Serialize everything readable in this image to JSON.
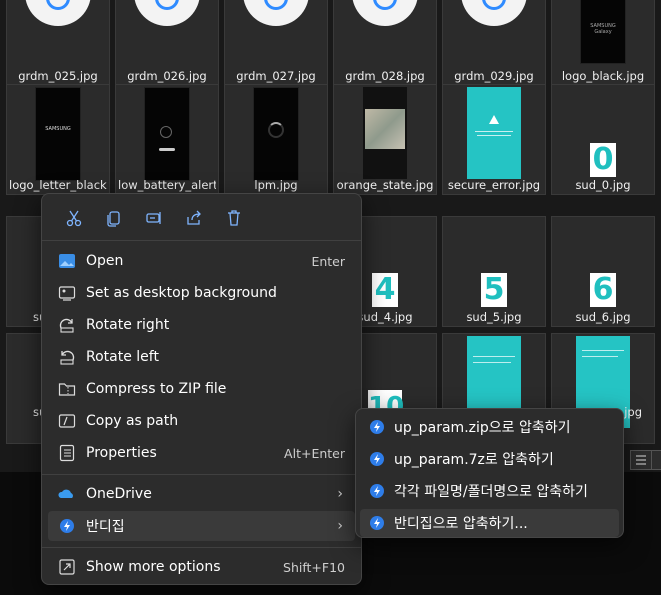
{
  "files": {
    "row1": [
      "grdm_025.jpg",
      "grdm_026.jpg",
      "grdm_027.jpg",
      "grdm_028.jpg",
      "grdm_029.jpg",
      "logo_black.jpg"
    ],
    "row2": [
      "logo_letter_black.",
      "low_battery_alert.",
      "lpm.jpg",
      "orange_state.jpg",
      "secure_error.jpg",
      "sud_0.jpg"
    ],
    "row3": [
      "su",
      "sud_4.jpg",
      "sud_5.jpg",
      "sud_6.jpg"
    ],
    "row4": [
      "su",
      "jpg"
    ],
    "thumb_text": {
      "samsung": "SAMSUNG",
      "samsung_galaxy": "SAMSUNG Galaxy",
      "digits": [
        "0",
        "4",
        "5",
        "6",
        "10"
      ]
    }
  },
  "quick_actions": [
    "cut-icon",
    "copy-icon",
    "rename-icon",
    "share-icon",
    "delete-icon"
  ],
  "menu": {
    "open": {
      "label": "Open",
      "shortcut": "Enter"
    },
    "set_bg": {
      "label": "Set as desktop background"
    },
    "rotate_right": {
      "label": "Rotate right"
    },
    "rotate_left": {
      "label": "Rotate left"
    },
    "compress": {
      "label": "Compress to ZIP file"
    },
    "copy_path": {
      "label": "Copy as path"
    },
    "properties": {
      "label": "Properties",
      "shortcut": "Alt+Enter"
    },
    "onedrive": {
      "label": "OneDrive",
      "arrow": "›"
    },
    "bandizip": {
      "label": "반디집",
      "arrow": "›"
    },
    "more": {
      "label": "Show more options",
      "shortcut": "Shift+F10"
    }
  },
  "submenu": [
    "up_param.zip으로 압축하기",
    "up_param.7z로 압축하기",
    "각각 파일명/폴더명으로 압축하기",
    "반디집으로 압축하기..."
  ],
  "colors": {
    "accent": "#2f8bff",
    "teal": "#25c4c4",
    "bandizip": "#2e7de9",
    "onedrive": "#3a9bef"
  }
}
